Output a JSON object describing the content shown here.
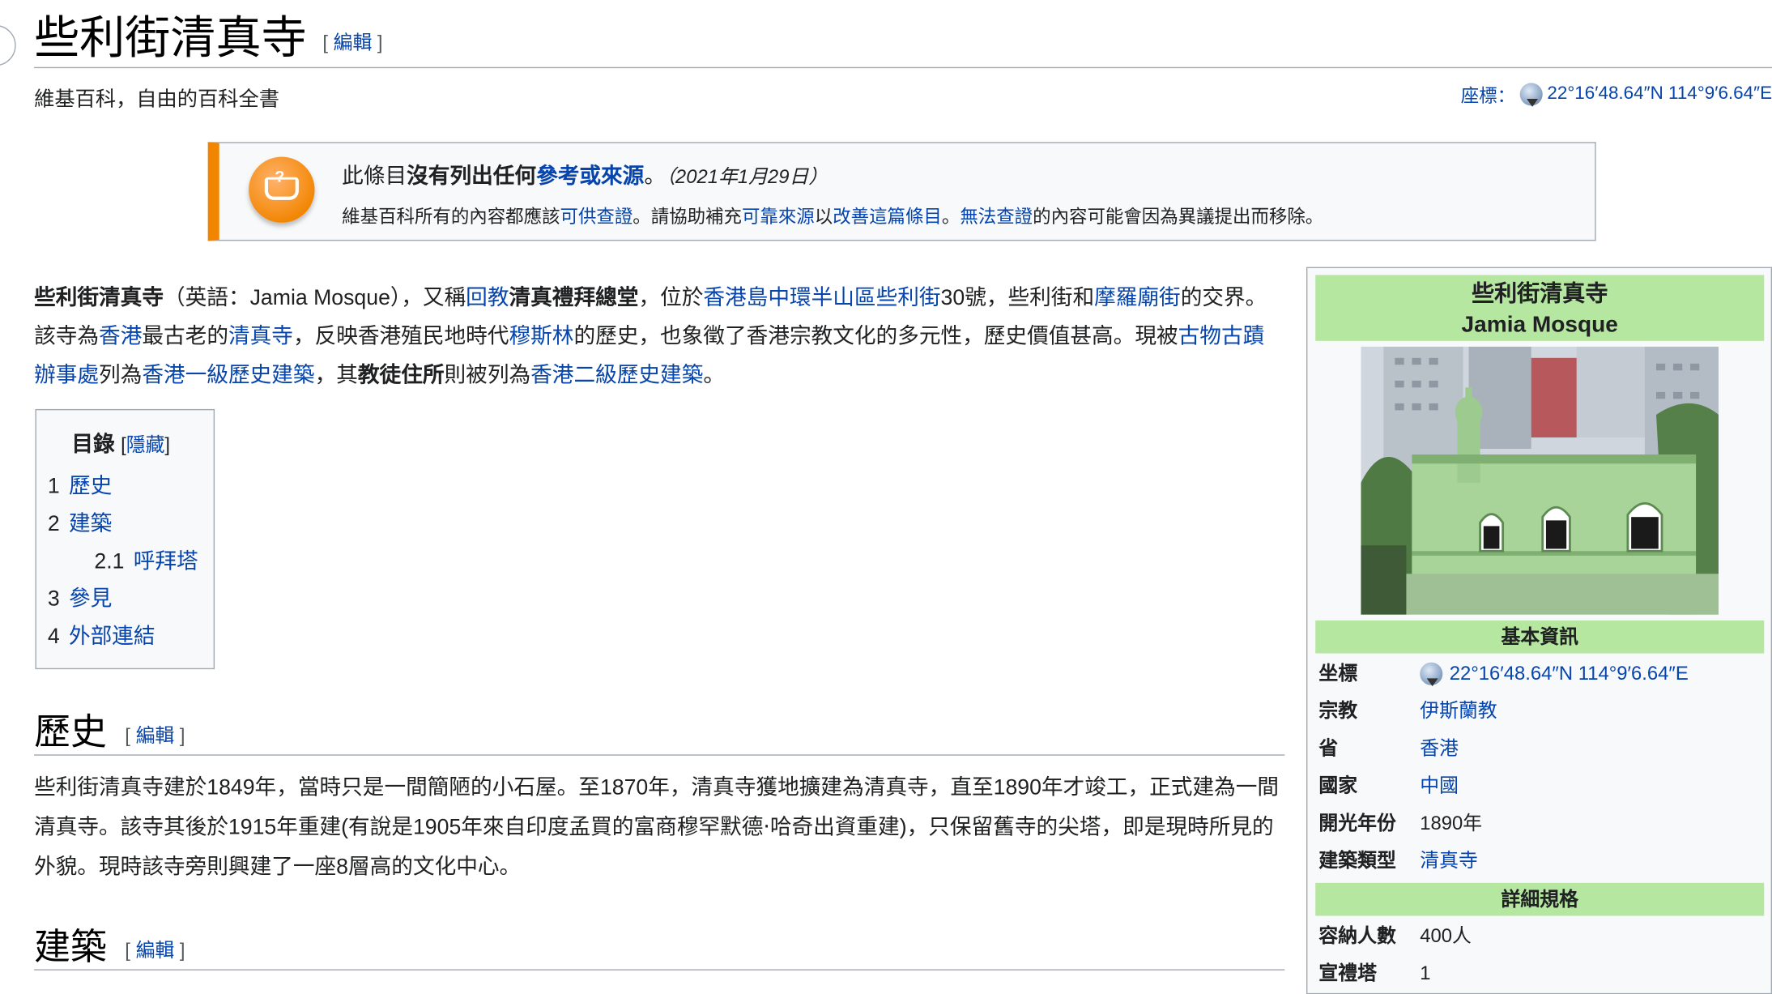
{
  "page": {
    "title": "些利街清真寺",
    "edit_label": "編輯",
    "tagline": "維基百科，自由的百科全書",
    "coords_label": "座標：",
    "coords_value": "22°16′48.64″N 114°9′6.64″E"
  },
  "notice": {
    "prefix": "此條目",
    "bold": "沒有列出任何",
    "link_refs": "參考或來源",
    "end": "。",
    "date": "（2021年1月29日）",
    "l2_a": "維基百科所有的內容都應該",
    "l2_link1": "可供查證",
    "l2_b": "。請協助補充",
    "l2_link2": "可靠來源",
    "l2_c": "以",
    "l2_link3": "改善這篇條目",
    "l2_d": "。",
    "l2_link4": "無法查證",
    "l2_e": "的內容可能會因為異議提出而移除。"
  },
  "lead": {
    "t1": "些利街清真寺",
    "t2": "（英語：Jamia Mosque），又稱",
    "l1": "回教",
    "t3": "清真禮拜總堂",
    "t4": "，位於",
    "l2": "香港島中環半山區些利街",
    "t5": "30號，些利街和",
    "l3": "摩羅廟街",
    "t6": "的交界。該寺為",
    "l4": "香港",
    "t7": "最古老的",
    "l5": "清真寺",
    "t8": "，反映香港殖民地時代",
    "l6": "穆斯林",
    "t9": "的歷史，也象徵了香港宗教文化的多元性，歷史價值甚高。現被",
    "l7": "古物古蹟辦事處",
    "t10": "列為",
    "l8": "香港一級歷史建築",
    "t11": "，其",
    "t12": "教徒住所",
    "t13": "則被列為",
    "l9": "香港二級歷史建築",
    "t14": "。"
  },
  "toc": {
    "title": "目錄",
    "hide_label": "隱藏",
    "items": [
      {
        "num": "1",
        "label": "歷史"
      },
      {
        "num": "2",
        "label": "建築"
      },
      {
        "num": "2.1",
        "label": "呼拜塔"
      },
      {
        "num": "3",
        "label": "參見"
      },
      {
        "num": "4",
        "label": "外部連結"
      }
    ]
  },
  "sections": {
    "history_title": "歷史",
    "history_text": "些利街清真寺建於1849年，當時只是一間簡陋的小石屋。至1870年，清真寺獲地擴建為清真寺，直至1890年才竣工，正式建為一間清真寺。該寺其後於1915年重建(有說是1905年來自印度孟買的富商穆罕默德‧哈奇出資重建)，只保留舊寺的尖塔，即是現時所見的外貌。現時該寺旁則興建了一座8層高的文化中心。",
    "arch_title": "建築"
  },
  "infobox": {
    "title_zh": "些利街清真寺",
    "title_en": "Jamia Mosque",
    "basic_header": "基本資訊",
    "spec_header": "詳細規格",
    "rows": [
      {
        "label": "坐標",
        "value": "22°16′48.64″N 114°9′6.64″E"
      },
      {
        "label": "宗教",
        "value": "伊斯蘭教"
      },
      {
        "label": "省",
        "value": "香港"
      },
      {
        "label": "國家",
        "value": "中國"
      },
      {
        "label": "開光年份",
        "value": "1890年"
      },
      {
        "label": "建築類型",
        "value": "清真寺"
      }
    ],
    "spec_rows": [
      {
        "label": "容納人數",
        "value": "400人"
      },
      {
        "label": "宣禮塔",
        "value": "1"
      }
    ]
  },
  "colors": {
    "link": "#0645ad",
    "infobox_header": "#b5e7a0",
    "notice_accent": "#f28500"
  }
}
